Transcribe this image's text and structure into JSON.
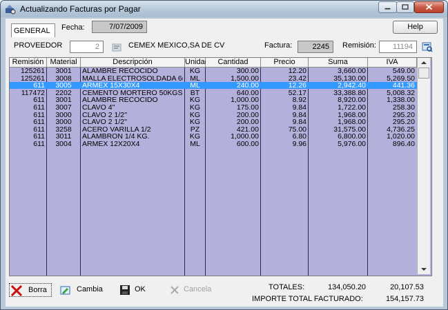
{
  "window": {
    "title": "Actualizando Facturas por Pagar"
  },
  "tabs": [
    {
      "label": "GENERAL"
    }
  ],
  "header": {
    "fecha_label": "Fecha:",
    "fecha_value": "7/07/2009",
    "help_label": "Help"
  },
  "proveedor": {
    "label": "PROVEEDOR",
    "code": "2",
    "name": "CEMEX MEXICO,SA DE CV",
    "factura_label": "Factura:",
    "factura_value": "2245",
    "remision_label": "Remisión:",
    "remision_value": "11194"
  },
  "table": {
    "columns": [
      "Remisión",
      "Material",
      "Descripción",
      "Unidad",
      "Cantidad",
      "Precio",
      "Suma",
      "IVA"
    ],
    "selected_row": 2,
    "rows": [
      [
        "125261",
        "3001",
        "ALAMBRE RECOCIDO",
        "KG",
        "300.00",
        "12.20",
        "3,660.00",
        "549.00"
      ],
      [
        "125261",
        "3008",
        "MALLA ELECTROSOLDADA 6(",
        "ML",
        "1,500.00",
        "23.42",
        "35,130.00",
        "5,269.50"
      ],
      [
        "611",
        "3005",
        "ARMEX 15X30X4",
        "ML",
        "240.00",
        "12.26",
        "2,942.40",
        "441.36"
      ],
      [
        "117472",
        "2202",
        "CEMENTO MORTERO 50KGS",
        "BT",
        "640.00",
        "52.17",
        "33,388.80",
        "5,008.32"
      ],
      [
        "611",
        "3001",
        "ALAMBRE RECOCIDO",
        "KG",
        "1,000.00",
        "8.92",
        "8,920.00",
        "1,338.00"
      ],
      [
        "611",
        "3007",
        "CLAVO 4''",
        "KG",
        "175.00",
        "9.84",
        "1,722.00",
        "258.30"
      ],
      [
        "611",
        "3000",
        "CLAVO 2 1/2''",
        "KG",
        "200.00",
        "9.84",
        "1,968.00",
        "295.20"
      ],
      [
        "611",
        "3000",
        "CLAVO 2 1/2''",
        "KG",
        "200.00",
        "9.84",
        "1,968.00",
        "295.20"
      ],
      [
        "611",
        "3258",
        "ACERO VARILLA 1/2",
        "PZ",
        "421.00",
        "75.00",
        "31,575.00",
        "4,736.25"
      ],
      [
        "611",
        "3011",
        "ALAMBRON 1/4 KG.",
        "KG",
        "1,000.00",
        "6.80",
        "6,800.00",
        "1,020.00"
      ],
      [
        "611",
        "3004",
        "ARMEX 12X20X4",
        "ML",
        "600.00",
        "9.96",
        "5,976.00",
        "896.40"
      ]
    ]
  },
  "toolbar": {
    "borra_label": "Borra",
    "cambia_label": "Cambia",
    "ok_label": "OK",
    "cancela_label": "Cancela"
  },
  "totals": {
    "totales_label": "TOTALES:",
    "suma_total": "134,050.20",
    "iva_total": "20,107.53",
    "importe_label": "IMPORTE TOTAL FACTURADO:",
    "importe_total": "154,157.73"
  },
  "colors": {
    "grid_bg": "#b4b0dc",
    "selection": "#3399ff"
  }
}
